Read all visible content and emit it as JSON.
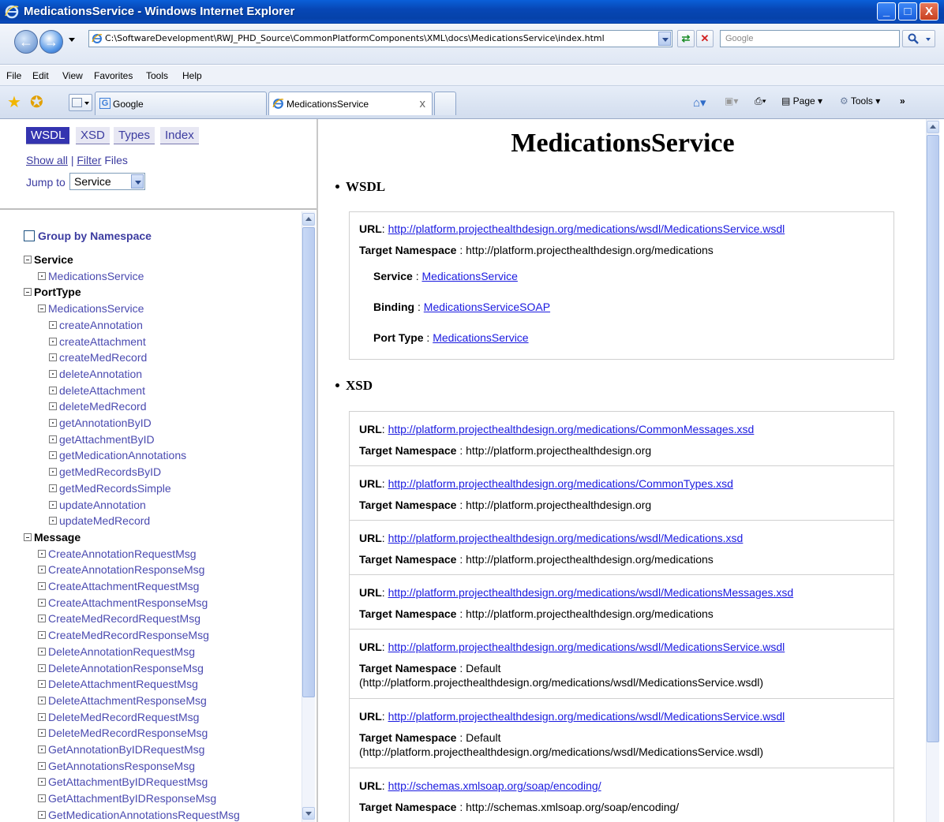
{
  "window": {
    "title": "MedicationsService - Windows Internet Explorer",
    "min": "_",
    "max": "□",
    "close": "X"
  },
  "address": {
    "url": "C:\\SoftwareDevelopment\\RWJ_PHD_Source\\CommonPlatformComponents\\XML\\docs\\MedicationsService\\index.html",
    "search_placeholder": "Google"
  },
  "menu": [
    "File",
    "Edit",
    "View",
    "Favorites",
    "Tools",
    "Help"
  ],
  "tabs": [
    {
      "label": "Google",
      "icon": "google-icon"
    },
    {
      "label": "MedicationsService",
      "icon": "ie-icon",
      "close": "x"
    }
  ],
  "commandbar": {
    "page": "Page",
    "tools": "Tools"
  },
  "left": {
    "tabs": [
      "WSDL",
      "XSD",
      "Types",
      "Index"
    ],
    "active_tab": "WSDL",
    "show_all": "Show all",
    "separator": "|",
    "filter": "Filter",
    "files": "Files",
    "jump_label": "Jump to",
    "jump_value": "Service",
    "group_by_ns": "Group by Namespace",
    "tree": {
      "service_h": "Service",
      "service_items": [
        "MedicationsService"
      ],
      "porttype_h": "PortType",
      "porttype_item": "MedicationsService",
      "operations": [
        "createAnnotation",
        "createAttachment",
        "createMedRecord",
        "deleteAnnotation",
        "deleteAttachment",
        "deleteMedRecord",
        "getAnnotationByID",
        "getAttachmentByID",
        "getMedicationAnnotations",
        "getMedRecordsByID",
        "getMedRecordsSimple",
        "updateAnnotation",
        "updateMedRecord"
      ],
      "message_h": "Message",
      "messages": [
        "CreateAnnotationRequestMsg",
        "CreateAnnotationResponseMsg",
        "CreateAttachmentRequestMsg",
        "CreateAttachmentResponseMsg",
        "CreateMedRecordRequestMsg",
        "CreateMedRecordResponseMsg",
        "DeleteAnnotationRequestMsg",
        "DeleteAnnotationResponseMsg",
        "DeleteAttachmentRequestMsg",
        "DeleteAttachmentResponseMsg",
        "DeleteMedRecordRequestMsg",
        "DeleteMedRecordResponseMsg",
        "GetAnnotationByIDRequestMsg",
        "GetAnnotationsResponseMsg",
        "GetAttachmentByIDRequestMsg",
        "GetAttachmentByIDResponseMsg",
        "GetMedicationAnnotationsRequestMsg"
      ]
    }
  },
  "doc": {
    "title": "MedicationsService",
    "wsdl_heading": "WSDL",
    "xsd_heading": "XSD",
    "labels": {
      "url": "URL",
      "tns": "Target Namespace",
      "service": "Service",
      "binding": "Binding",
      "port_type": "Port Type",
      "colon": ":"
    },
    "wsdl": {
      "url": "http://platform.projecthealthdesign.org/medications/wsdl/MedicationsService.wsdl",
      "tns": "http://platform.projecthealthdesign.org/medications",
      "service": "MedicationsService",
      "binding": "MedicationsServiceSOAP",
      "port_type": "MedicationsService"
    },
    "xsd": [
      {
        "url": "http://platform.projecthealthdesign.org/medications/CommonMessages.xsd",
        "tns": "http://platform.projecthealthdesign.org"
      },
      {
        "url": "http://platform.projecthealthdesign.org/medications/CommonTypes.xsd",
        "tns": "http://platform.projecthealthdesign.org"
      },
      {
        "url": "http://platform.projecthealthdesign.org/medications/wsdl/Medications.xsd",
        "tns": "http://platform.projecthealthdesign.org/medications"
      },
      {
        "url": "http://platform.projecthealthdesign.org/medications/wsdl/MedicationsMessages.xsd",
        "tns": "http://platform.projecthealthdesign.org/medications"
      },
      {
        "url": "http://platform.projecthealthdesign.org/medications/wsdl/MedicationsService.wsdl",
        "tns": "Default",
        "tns2": "(http://platform.projecthealthdesign.org/medications/wsdl/MedicationsService.wsdl)"
      },
      {
        "url": "http://platform.projecthealthdesign.org/medications/wsdl/MedicationsService.wsdl",
        "tns": "Default",
        "tns2": "(http://platform.projecthealthdesign.org/medications/wsdl/MedicationsService.wsdl)"
      },
      {
        "url": "http://schemas.xmlsoap.org/soap/encoding/",
        "tns": "http://schemas.xmlsoap.org/soap/encoding/"
      }
    ]
  }
}
